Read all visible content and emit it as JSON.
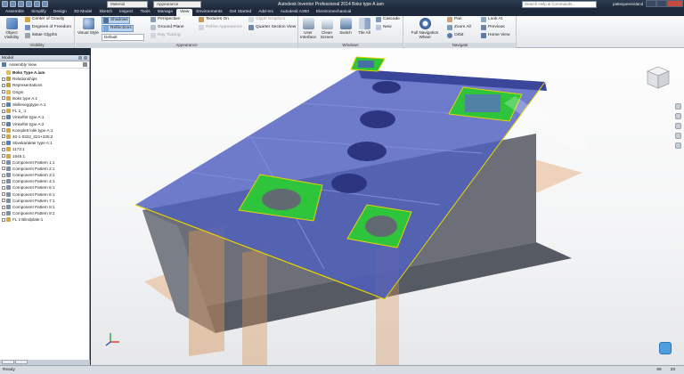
{
  "titlebar": {
    "material_combo": "Material",
    "appearance_combo": "Appearance",
    "title": "Autodesk Inventor Professional 2014   Boks type A.iam",
    "search_placeholder": "Search Help & Commands...",
    "user": "pattequeenisland"
  },
  "tabs": [
    "Assemble",
    "Simplify",
    "Design",
    "3D Model",
    "Sketch",
    "Inspect",
    "Tools",
    "Manage",
    "View",
    "Environments",
    "Get Started",
    "Add-Ins",
    "Autodesk A360",
    "Electromechanical"
  ],
  "active_tab": "View",
  "ribbon": {
    "visibility": {
      "title": "Visibility",
      "object_visibility": "Object Visibility",
      "center_of_gravity": "Center of Gravity",
      "degrees_of_freedom": "Degrees of Freedom",
      "imate_glyphs": "iMate Glyphs"
    },
    "appearance": {
      "title": "Appearance",
      "visual_style": "Visual Style",
      "shadows": "Shadows",
      "reflections": "Reflections",
      "default": "Default",
      "perspective": "Perspective",
      "ground_plane": "Ground Plane",
      "ray_tracing": "Ray Tracing",
      "textures_on": "Textures On",
      "refine_appearance": "Refine Appearance",
      "glyph_graphics": "Glyph Graphics",
      "quarter_section_view": "Quarter Section View"
    },
    "windows": {
      "title": "Windows",
      "user_interface": "User Interface",
      "clean_screen": "Clean Screen",
      "switch": "Switch",
      "tile_all": "Tile All",
      "cascade": "Cascade",
      "new": "New"
    },
    "navigate": {
      "title": "Navigate",
      "full_navigation_wheel": "Full Navigation Wheel",
      "pan": "Pan",
      "zoom_all": "Zoom All",
      "orbit": "Orbit",
      "look_at": "Look At",
      "previous": "Previous",
      "home_view": "Home View"
    }
  },
  "browser": {
    "title": "Model",
    "view_label": "Assembly View",
    "items": [
      {
        "label": "Boks Type A.iam",
        "icon_color": "#e6b74a",
        "root": true
      },
      {
        "label": "Relationships",
        "icon_color": "#c79a3a"
      },
      {
        "label": "Representations",
        "icon_color": "#c79a3a"
      },
      {
        "label": "Origin",
        "icon_color": "#e6b74a"
      },
      {
        "label": "Boks type A:1",
        "icon_color": "#d9a441"
      },
      {
        "label": "Skilleveggtype A:1",
        "icon_color": "#5a7fb3"
      },
      {
        "label": "FL 2_:1",
        "icon_color": "#d9a441"
      },
      {
        "label": "Vinkelfot type A:1",
        "icon_color": "#5a7fb3"
      },
      {
        "label": "Vinkelfot type A:2",
        "icon_color": "#5a7fb3"
      },
      {
        "label": "Komplett lokk type A:1",
        "icon_color": "#d9a441"
      },
      {
        "label": "40-1-0322_021+335:2",
        "icon_color": "#d9a441"
      },
      {
        "label": "Stivekarakter type A:1",
        "icon_color": "#5a7fb3"
      },
      {
        "label": "1172:1",
        "icon_color": "#d9a441"
      },
      {
        "label": "1545:1",
        "icon_color": "#d9a441"
      },
      {
        "label": "Component Pattern 1:1",
        "icon_color": "#7d8fa8"
      },
      {
        "label": "Component Pattern 2:1",
        "icon_color": "#7d8fa8"
      },
      {
        "label": "Component Pattern 3:1",
        "icon_color": "#7d8fa8"
      },
      {
        "label": "Component Pattern 4:1",
        "icon_color": "#7d8fa8"
      },
      {
        "label": "Component Pattern 5:1",
        "icon_color": "#7d8fa8"
      },
      {
        "label": "Component Pattern 6:1",
        "icon_color": "#7d8fa8"
      },
      {
        "label": "Component Pattern 7:1",
        "icon_color": "#7d8fa8"
      },
      {
        "label": "Component Pattern 8:1",
        "icon_color": "#7d8fa8"
      },
      {
        "label": "Component Pattern 9:1",
        "icon_color": "#7d8fa8"
      },
      {
        "label": "FL 2 Blindplate:1",
        "icon_color": "#d9a441"
      }
    ]
  },
  "status": {
    "text": "Ready",
    "count_a": "69",
    "count_b": "28"
  },
  "colors": {
    "lid": "#4f5fbf",
    "pad": "#2ec43c",
    "wall": "#c87a2e",
    "edge": "#e8d400"
  }
}
